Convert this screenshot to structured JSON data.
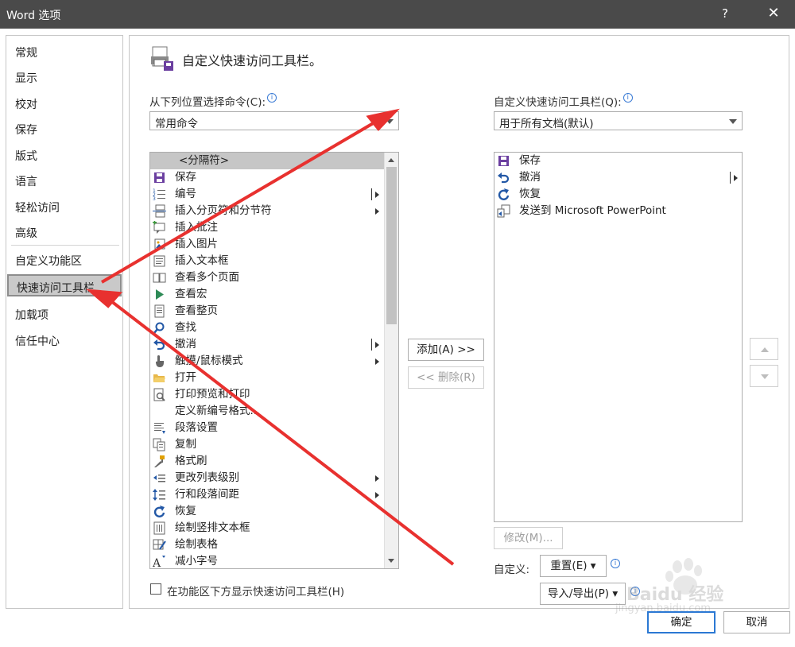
{
  "window": {
    "title": "Word 选项",
    "help_label": "?",
    "close_label": "✕"
  },
  "nav": {
    "items": [
      {
        "label": "常规"
      },
      {
        "label": "显示"
      },
      {
        "label": "校对"
      },
      {
        "label": "保存"
      },
      {
        "label": "版式"
      },
      {
        "label": "语言"
      },
      {
        "label": "轻松访问"
      },
      {
        "label": "高级"
      },
      {
        "label": "自定义功能区"
      },
      {
        "label": "快速访问工具栏"
      },
      {
        "label": "加载项"
      },
      {
        "label": "信任中心"
      }
    ],
    "active_index": 9
  },
  "header": {
    "title": "自定义快速访问工具栏。",
    "icon": "toolbar-printer-icon"
  },
  "choose": {
    "label": "从下列位置选择命令(C):",
    "info_label": "i",
    "selected": "常用命令"
  },
  "customize": {
    "label": "自定义快速访问工具栏(Q):",
    "info_label": "i",
    "selected": "用于所有文档(默认)"
  },
  "commands": [
    {
      "label": "<分隔符>",
      "icon": "",
      "submenu": ""
    },
    {
      "label": "保存",
      "icon": "save-icon",
      "submenu": ""
    },
    {
      "label": "编号",
      "icon": "numbering-icon",
      "submenu": "split"
    },
    {
      "label": "插入分页符和分节符",
      "icon": "page-break-icon",
      "submenu": "arrow"
    },
    {
      "label": "插入批注",
      "icon": "comment-icon",
      "submenu": ""
    },
    {
      "label": "插入图片",
      "icon": "picture-icon",
      "submenu": ""
    },
    {
      "label": "插入文本框",
      "icon": "textbox-icon",
      "submenu": ""
    },
    {
      "label": "查看多个页面",
      "icon": "multipage-icon",
      "submenu": ""
    },
    {
      "label": "查看宏",
      "icon": "macro-play-icon",
      "submenu": ""
    },
    {
      "label": "查看整页",
      "icon": "full-page-icon",
      "submenu": ""
    },
    {
      "label": "查找",
      "icon": "find-icon",
      "submenu": ""
    },
    {
      "label": "撤消",
      "icon": "undo-icon",
      "submenu": "split"
    },
    {
      "label": "触摸/鼠标模式",
      "icon": "touch-icon",
      "submenu": "arrow"
    },
    {
      "label": "打开",
      "icon": "open-folder-icon",
      "submenu": ""
    },
    {
      "label": "打印预览和打印",
      "icon": "print-preview-icon",
      "submenu": ""
    },
    {
      "label": "定义新编号格式...",
      "icon": "",
      "submenu": ""
    },
    {
      "label": "段落设置",
      "icon": "paragraph-icon",
      "submenu": ""
    },
    {
      "label": "复制",
      "icon": "copy-icon",
      "submenu": ""
    },
    {
      "label": "格式刷",
      "icon": "format-painter-icon",
      "submenu": ""
    },
    {
      "label": "更改列表级别",
      "icon": "list-level-icon",
      "submenu": "arrow"
    },
    {
      "label": "行和段落间距",
      "icon": "line-spacing-icon",
      "submenu": "arrow"
    },
    {
      "label": "恢复",
      "icon": "redo-icon",
      "submenu": ""
    },
    {
      "label": "绘制竖排文本框",
      "icon": "vertical-textbox-icon",
      "submenu": ""
    },
    {
      "label": "绘制表格",
      "icon": "draw-table-icon",
      "submenu": ""
    },
    {
      "label": "减小字号",
      "icon": "shrink-font-icon",
      "submenu": ""
    }
  ],
  "toolbar_items": [
    {
      "label": "保存",
      "icon": "save-icon",
      "submenu": ""
    },
    {
      "label": "撤消",
      "icon": "undo-icon",
      "submenu": "split"
    },
    {
      "label": "恢复",
      "icon": "redo-icon",
      "submenu": ""
    },
    {
      "label": "发送到 Microsoft PowerPoint",
      "icon": "send-to-powerpoint-icon",
      "submenu": ""
    }
  ],
  "buttons": {
    "add": "添加(A) >>",
    "remove": "<< 删除(R)",
    "modify": "修改(M)...",
    "customize_label": "自定义:",
    "reset": "重置(E) ▾",
    "import_export": "导入/导出(P) ▾",
    "ok": "确定",
    "cancel": "取消"
  },
  "checkbox": {
    "label": "在功能区下方显示快速访问工具栏(H)",
    "checked": false
  },
  "watermark": {
    "brand": "Baidu 经验",
    "url": "jingyan.baidu.com"
  },
  "colors": {
    "accent": "#2b78d3",
    "annotation_arrow": "#e8312f",
    "titlebar": "#4a4a4a",
    "icon_purple": "#6b3fa0",
    "icon_blue": "#2358a6"
  }
}
